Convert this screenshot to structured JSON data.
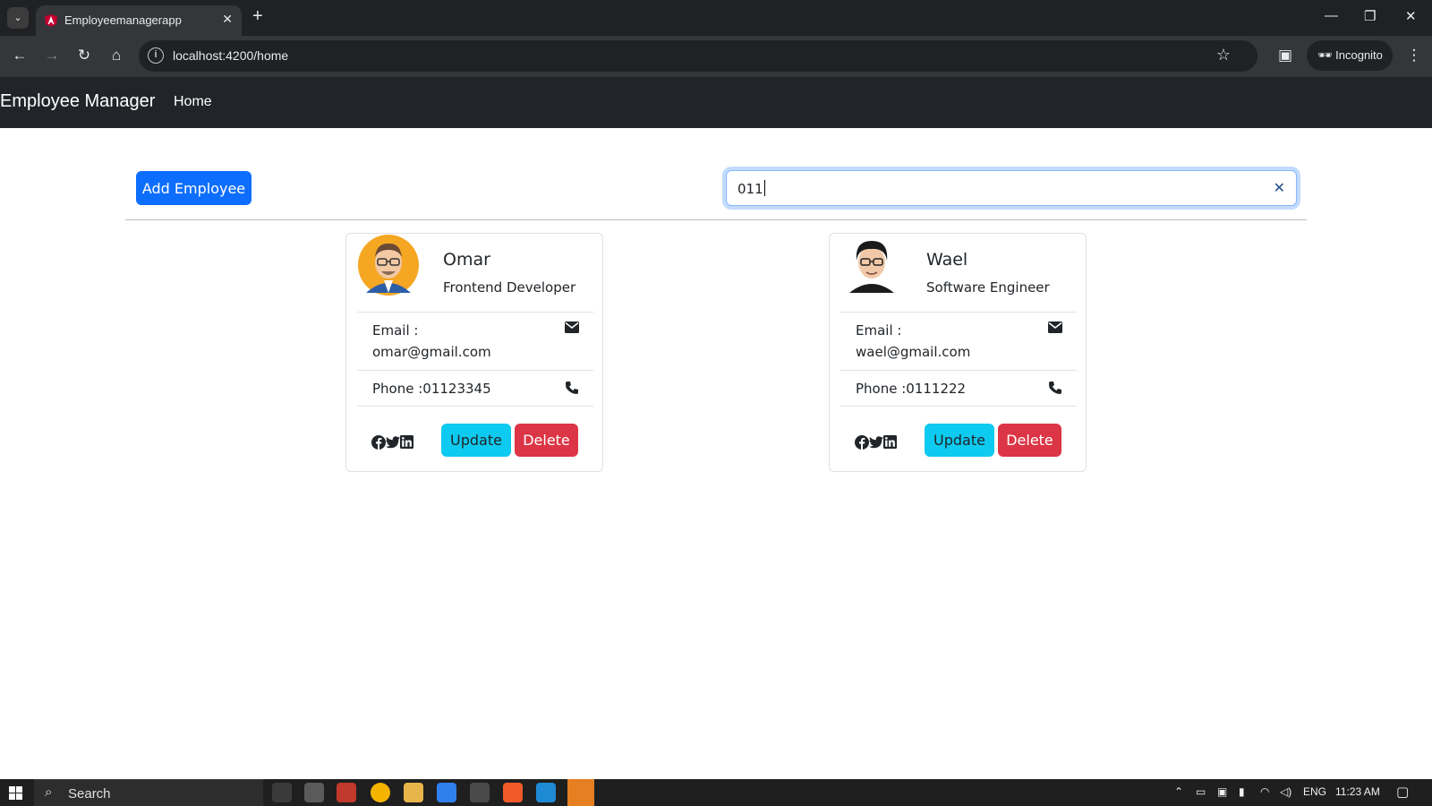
{
  "browser": {
    "tab_title": "Employeemanagerapp",
    "url": "localhost:4200/home",
    "incognito_label": "Incognito"
  },
  "app": {
    "brand": "Employee Manager",
    "nav_home": "Home",
    "add_button": "Add Employee",
    "search_value": "011"
  },
  "employees": [
    {
      "name": "Omar",
      "job_title": "Frontend Developer",
      "email_label": "Email :",
      "email": "omar@gmail.com",
      "phone": "Phone :01123345",
      "update_label": "Update",
      "delete_label": "Delete"
    },
    {
      "name": "Wael",
      "job_title": "Software Engineer",
      "email_label": "Email :",
      "email": "wael@gmail.com",
      "phone": "Phone :0111222",
      "update_label": "Update",
      "delete_label": "Delete"
    }
  ],
  "taskbar": {
    "search_label": "Search",
    "language": "ENG",
    "time": "11:23 AM"
  },
  "colors": {
    "primary": "#0d6efd",
    "info": "#0dcaf0",
    "danger": "#dc3545",
    "navbar": "#212529"
  }
}
